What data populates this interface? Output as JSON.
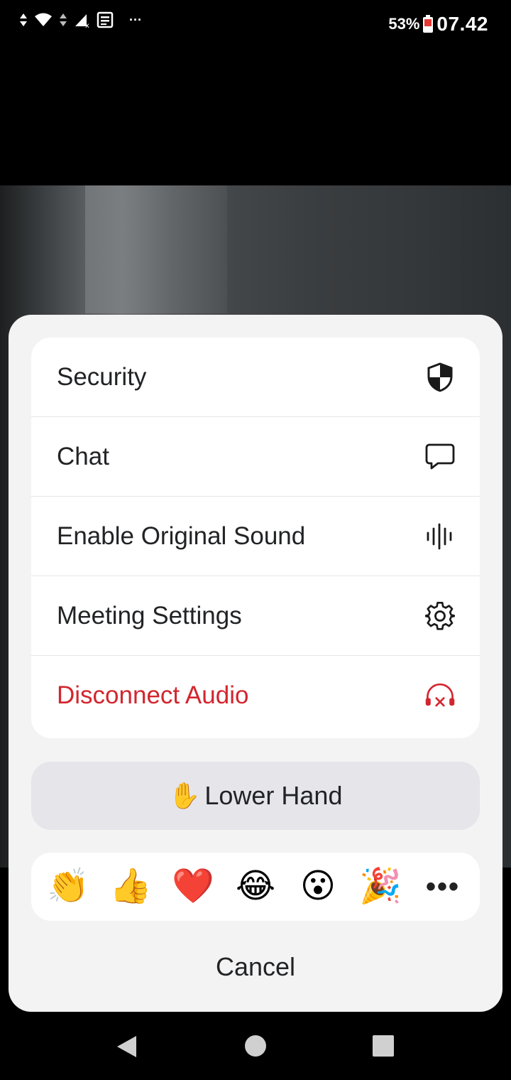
{
  "status_bar": {
    "battery_percent": "53%",
    "time": "07.42",
    "overflow": "···"
  },
  "menu": {
    "items": [
      {
        "label": "Security",
        "icon": "shield-icon"
      },
      {
        "label": "Chat",
        "icon": "chat-bubble-icon"
      },
      {
        "label": "Enable Original Sound",
        "icon": "sound-wave-icon"
      },
      {
        "label": "Meeting Settings",
        "icon": "gear-icon"
      },
      {
        "label": "Disconnect Audio",
        "icon": "headphones-disconnect-icon"
      }
    ],
    "danger_color": "#d2262f"
  },
  "raise_hand": {
    "emoji": "✋",
    "label": "Lower Hand"
  },
  "reactions": {
    "items": [
      "👏",
      "👍",
      "❤️",
      "😂",
      "😮",
      "🎉"
    ],
    "more": "•••"
  },
  "cancel_label": "Cancel"
}
